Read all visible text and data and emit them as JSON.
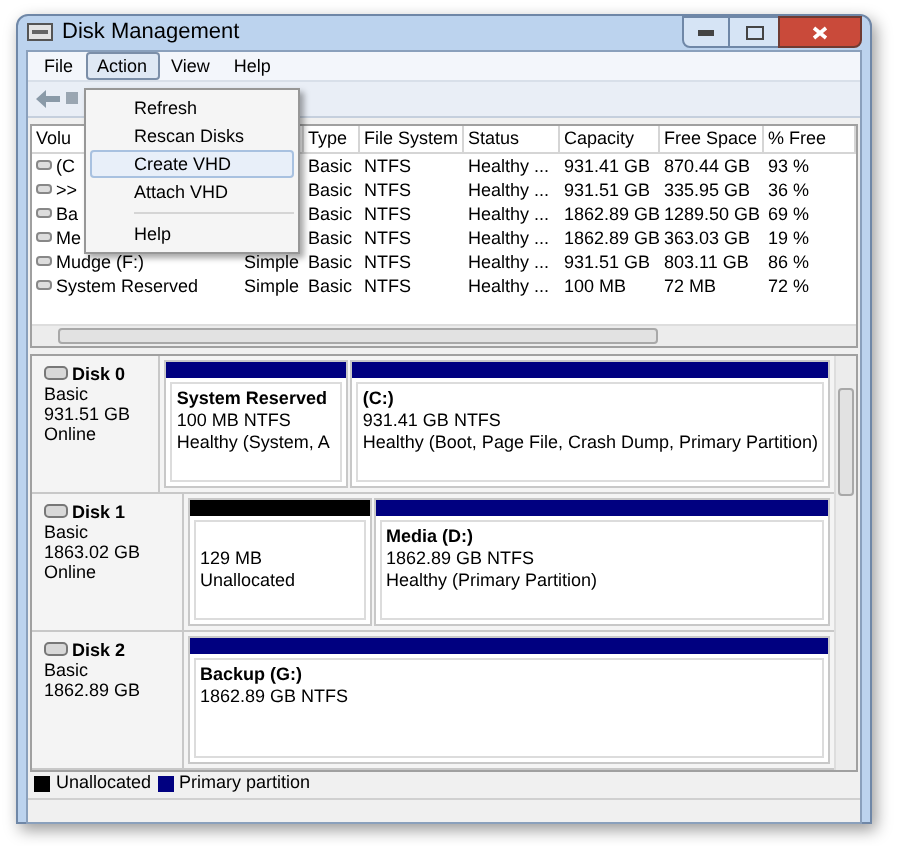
{
  "window": {
    "title": "Disk Management"
  },
  "menu_bar": [
    {
      "label": "File",
      "selected": false
    },
    {
      "label": "Action",
      "selected": true
    },
    {
      "label": "View",
      "selected": false
    },
    {
      "label": "Help",
      "selected": false
    }
  ],
  "action_menu": {
    "items": [
      {
        "kind": "item",
        "label": "Refresh",
        "selected": false
      },
      {
        "kind": "item",
        "label": "Rescan Disks",
        "selected": false
      },
      {
        "kind": "item",
        "label": "Create VHD",
        "selected": true
      },
      {
        "kind": "item",
        "label": "Attach VHD",
        "selected": false
      },
      {
        "kind": "separator"
      },
      {
        "kind": "item",
        "label": "Help",
        "selected": false
      }
    ]
  },
  "volume_table": {
    "columns": [
      "Volu",
      "Type",
      "File System",
      "Status",
      "Capacity",
      "Free Space",
      "% Free"
    ],
    "rows": [
      {
        "volume": "(C",
        "type": "Basic",
        "file_system": "NTFS",
        "status": "Healthy ...",
        "capacity": "931.41 GB",
        "free_space": "870.44 GB",
        "percent_free": "93 %"
      },
      {
        "volume": ">>",
        "type": "Basic",
        "file_system": "NTFS",
        "status": "Healthy ...",
        "capacity": "931.51 GB",
        "free_space": "335.95 GB",
        "percent_free": "36 %"
      },
      {
        "volume": "Ba",
        "type": "Basic",
        "file_system": "NTFS",
        "status": "Healthy ...",
        "capacity": "1862.89 GB",
        "free_space": "1289.50 GB",
        "percent_free": "69 %"
      },
      {
        "volume": "Me",
        "type": "Basic",
        "file_system": "NTFS",
        "status": "Healthy ...",
        "capacity": "1862.89 GB",
        "free_space": "363.03 GB",
        "percent_free": "19 %"
      },
      {
        "volume": "Mudge (F:)",
        "layout": "Simple",
        "type": "Basic",
        "file_system": "NTFS",
        "status": "Healthy ...",
        "capacity": "931.51 GB",
        "free_space": "803.11 GB",
        "percent_free": "86 %"
      },
      {
        "volume": "System Reserved",
        "layout": "Simple",
        "type": "Basic",
        "file_system": "NTFS",
        "status": "Healthy ...",
        "capacity": "100 MB",
        "free_space": "72 MB",
        "percent_free": "72 %"
      }
    ]
  },
  "disks": [
    {
      "name": "Disk 0",
      "type": "Basic",
      "size": "931.51 GB",
      "status": "Online",
      "partitions": [
        {
          "kind": "primary",
          "name": "System Reserved",
          "size": "100 MB NTFS",
          "health": "Healthy (System, A"
        },
        {
          "kind": "primary",
          "name": "(C:)",
          "size": "931.41 GB NTFS",
          "health": "Healthy (Boot, Page File, Crash Dump, Primary Partition)"
        }
      ]
    },
    {
      "name": "Disk 1",
      "type": "Basic",
      "size": "1863.02 GB",
      "status": "Online",
      "partitions": [
        {
          "kind": "unallocated",
          "size": "129 MB",
          "health": "Unallocated"
        },
        {
          "kind": "primary",
          "name": "Media  (D:)",
          "size": "1862.89 GB NTFS",
          "health": "Healthy (Primary Partition)"
        }
      ]
    },
    {
      "name": "Disk 2",
      "type": "Basic",
      "size": "1862.89 GB",
      "partitions": [
        {
          "kind": "primary",
          "name": "Backup   (G:)",
          "size": "1862.89 GB NTFS"
        }
      ]
    }
  ],
  "legend": [
    {
      "label": "Unallocated",
      "color": "#000000"
    },
    {
      "label": "Primary partition",
      "color": "#000080"
    }
  ]
}
